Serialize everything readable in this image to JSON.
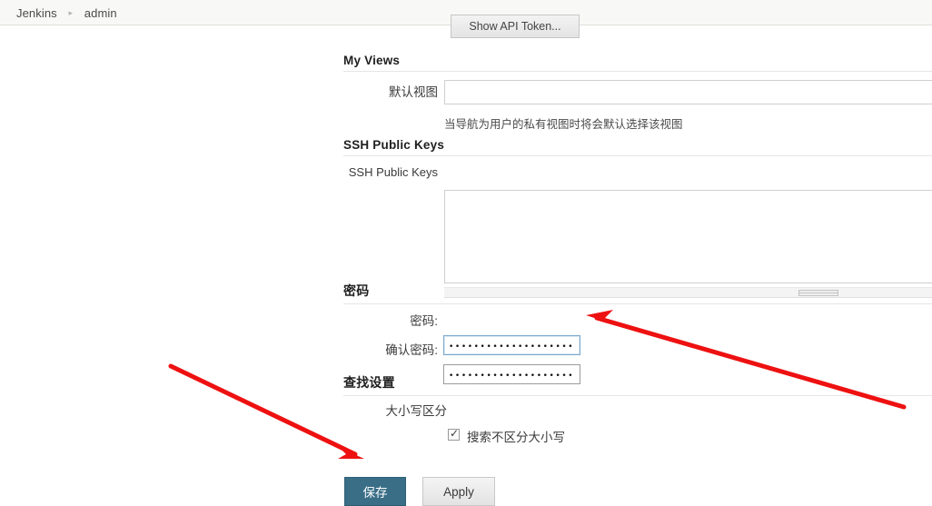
{
  "breadcrumb": {
    "root": "Jenkins",
    "separator": "▸",
    "current": "admin"
  },
  "top": {
    "show_api_token_label": "Show API Token..."
  },
  "sections": {
    "my_views": {
      "heading": "My Views",
      "default_view_label": "默认视图",
      "default_view_value": "",
      "default_view_help": "当导航为用户的私有视图时将会默认选择该视图"
    },
    "ssh_public_keys": {
      "heading": "SSH Public Keys",
      "field_label": "SSH Public Keys",
      "value": ""
    },
    "password": {
      "heading": "密码",
      "password_label": "密码:",
      "password_masked": "•••••••••••••••••••••••••••",
      "confirm_label": "确认密码:",
      "confirm_masked": "•••••••••••••••••••••••••••"
    },
    "search_settings": {
      "heading": "查找设置",
      "case_label": "大小写区分",
      "checkbox_label": "搜索不区分大小写",
      "checkbox_checked": true,
      "checkbox_glyph": "✓"
    }
  },
  "actions": {
    "save_label": "保存",
    "apply_label": "Apply"
  },
  "annotations": {
    "arrow_color": "#ee1111",
    "arrow_to_save_button": "arrow pointing down-right at 保存 button",
    "arrow_to_password_field": "arrow pointing up-left at 密码 input"
  },
  "colors": {
    "save_button_bg": "#3a6e87",
    "breadcrumb_bg": "#f8f8f6",
    "focus_border": "#7aa7cc",
    "page_bg": "#ffffff"
  }
}
